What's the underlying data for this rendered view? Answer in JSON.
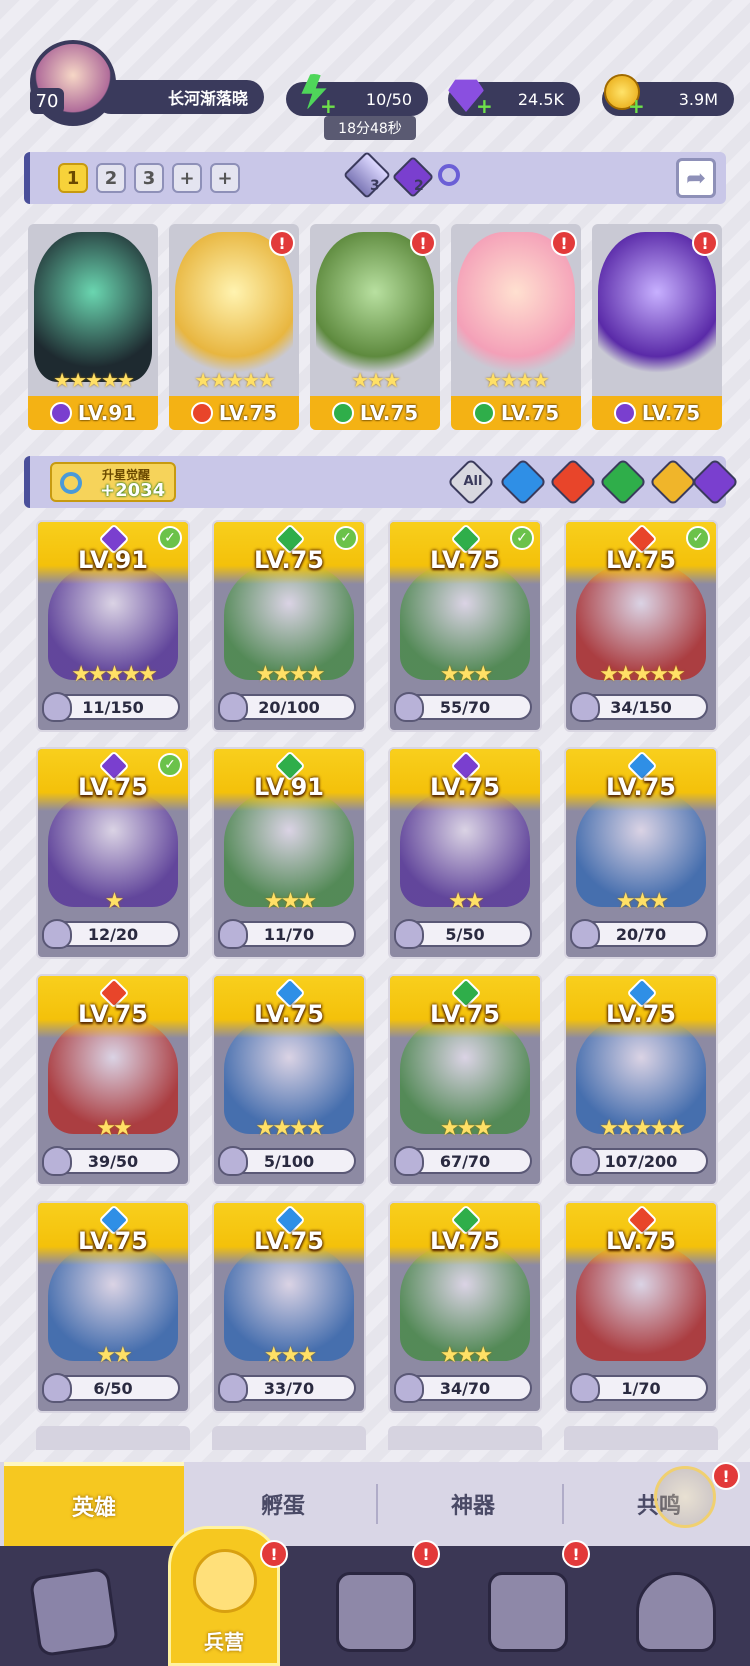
{
  "header": {
    "player_level": "70",
    "player_name": "长河渐落晓",
    "energy": "10/50",
    "energy_timer": "18分48秒",
    "gems": "24.5K",
    "gold": "3.9M"
  },
  "team_bar": {
    "slots": [
      "1",
      "2",
      "3",
      "+",
      "+"
    ],
    "cost_a": "3",
    "cost_b": "2"
  },
  "team": [
    {
      "level": "LV.91",
      "element": "dark",
      "stars": "★★★★★"
    },
    {
      "level": "LV.75",
      "element": "fire",
      "stars": "★★★★★"
    },
    {
      "level": "LV.75",
      "element": "nature",
      "stars": "★★★"
    },
    {
      "level": "LV.75",
      "element": "nature",
      "stars": "★★★★"
    },
    {
      "level": "LV.75",
      "element": "dark",
      "stars": ""
    }
  ],
  "filter_bar": {
    "awaken_label": "升星觉醒",
    "awaken_value": "+2034",
    "all_label": "All"
  },
  "heroes": [
    {
      "level": "LV.91",
      "element": "dark",
      "progress": "11/150",
      "stars": "★★★★★"
    },
    {
      "level": "LV.75",
      "element": "nature",
      "progress": "20/100",
      "stars": "★★★★"
    },
    {
      "level": "LV.75",
      "element": "nature",
      "progress": "55/70",
      "stars": "★★★"
    },
    {
      "level": "LV.75",
      "element": "fire",
      "progress": "34/150",
      "stars": "★★★★★"
    },
    {
      "level": "LV.75",
      "element": "dark",
      "progress": "12/20",
      "stars": "★"
    },
    {
      "level": "LV.91",
      "element": "nature",
      "progress": "11/70",
      "stars": "★★★"
    },
    {
      "level": "LV.75",
      "element": "dark",
      "progress": "5/50",
      "stars": "★★"
    },
    {
      "level": "LV.75",
      "element": "water",
      "progress": "20/70",
      "stars": "★★★"
    },
    {
      "level": "LV.75",
      "element": "fire",
      "progress": "39/50",
      "stars": "★★"
    },
    {
      "level": "LV.75",
      "element": "water",
      "progress": "5/100",
      "stars": "★★★★"
    },
    {
      "level": "LV.75",
      "element": "nature",
      "progress": "67/70",
      "stars": "★★★"
    },
    {
      "level": "LV.75",
      "element": "water",
      "progress": "107/200",
      "stars": "★★★★★"
    },
    {
      "level": "LV.75",
      "element": "water",
      "progress": "6/50",
      "stars": "★★"
    },
    {
      "level": "LV.75",
      "element": "water",
      "progress": "33/70",
      "stars": "★★★"
    },
    {
      "level": "LV.75",
      "element": "nature",
      "progress": "34/70",
      "stars": "★★★"
    },
    {
      "level": "LV.75",
      "element": "fire",
      "progress": "1/70",
      "stars": ""
    }
  ],
  "subtabs": [
    "英雄",
    "孵蛋",
    "神器",
    "共鸣"
  ],
  "bottom_nav": {
    "active_label": "兵营"
  },
  "colors": {
    "fire": "#e8452a",
    "water": "#2f8fe6",
    "nature": "#2fae4a",
    "dark": "#7a3fcf",
    "light": "#f0b52a",
    "gold": "#f4b214"
  }
}
